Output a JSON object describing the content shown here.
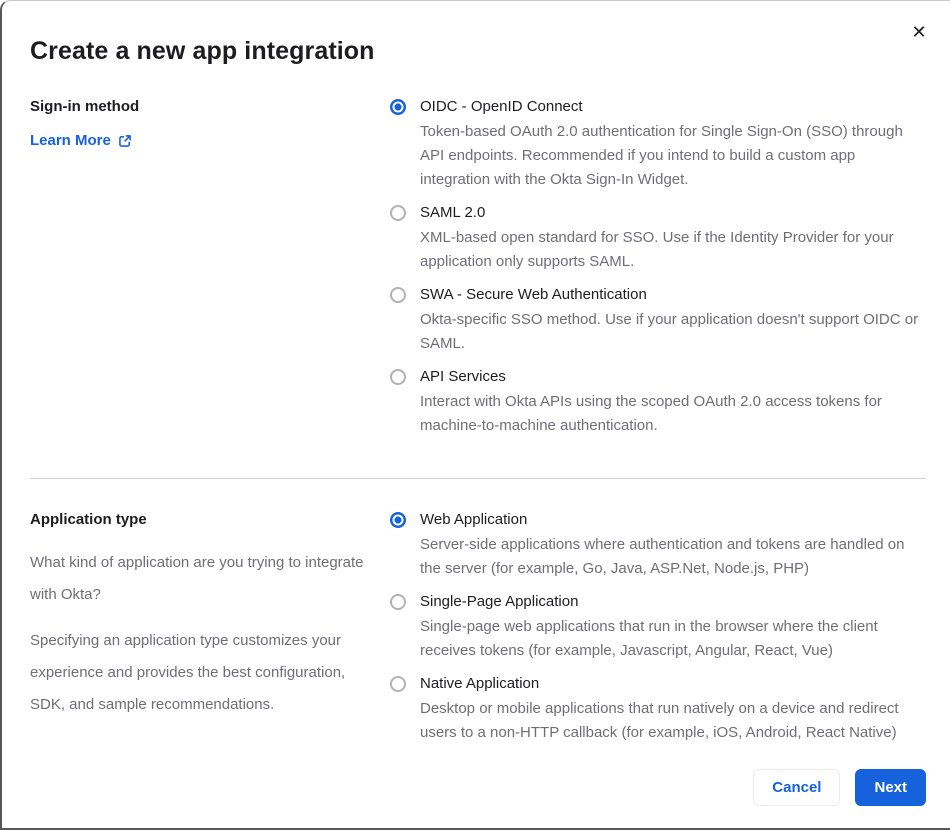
{
  "modal": {
    "title": "Create a new app integration",
    "close_label": "✕"
  },
  "signin_section": {
    "heading": "Sign-in method",
    "learn_more_label": "Learn More",
    "options": [
      {
        "label": "OIDC - OpenID Connect",
        "description": "Token-based OAuth 2.0 authentication for Single Sign-On (SSO) through API endpoints. Recommended if you intend to build a custom app integration with the Okta Sign-In Widget.",
        "selected": true
      },
      {
        "label": "SAML 2.0",
        "description": "XML-based open standard for SSO. Use if the Identity Provider for your application only supports SAML.",
        "selected": false
      },
      {
        "label": "SWA - Secure Web Authentication",
        "description": "Okta-specific SSO method. Use if your application doesn't support OIDC or SAML.",
        "selected": false
      },
      {
        "label": "API Services",
        "description": "Interact with Okta APIs using the scoped OAuth 2.0 access tokens for machine-to-machine authentication.",
        "selected": false
      }
    ]
  },
  "apptype_section": {
    "heading": "Application type",
    "paragraphs": [
      "What kind of application are you trying to integrate with Okta?",
      "Specifying an application type customizes your experience and provides the best configuration, SDK, and sample recommendations."
    ],
    "options": [
      {
        "label": "Web Application",
        "description": "Server-side applications where authentication and tokens are handled on the server (for example, Go, Java, ASP.Net, Node.js, PHP)",
        "selected": true
      },
      {
        "label": "Single-Page Application",
        "description": "Single-page web applications that run in the browser where the client receives tokens (for example, Javascript, Angular, React, Vue)",
        "selected": false
      },
      {
        "label": "Native Application",
        "description": "Desktop or mobile applications that run natively on a device and redirect users to a non-HTTP callback (for example, iOS, Android, React Native)",
        "selected": false
      }
    ]
  },
  "footer": {
    "cancel_label": "Cancel",
    "next_label": "Next"
  },
  "colors": {
    "primary_blue": "#1662dd",
    "text_dark": "#1d1d21",
    "text_gray": "#6e6e78",
    "divider_gray": "#d2d2d7"
  }
}
